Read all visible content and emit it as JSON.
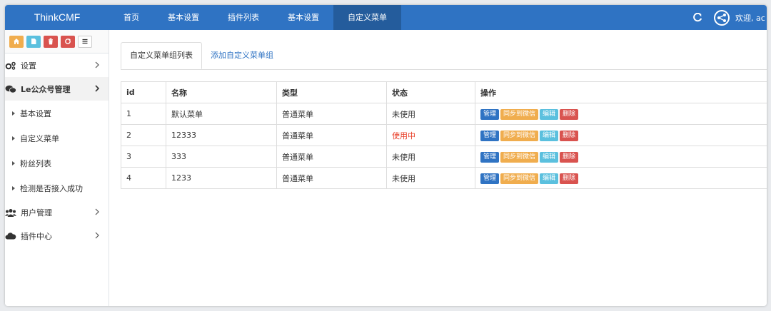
{
  "app": {
    "brand": "ThinkCMF"
  },
  "nav": {
    "items": [
      {
        "label": "首页"
      },
      {
        "label": "基本设置"
      },
      {
        "label": "插件列表"
      },
      {
        "label": "基本设置"
      },
      {
        "label": "自定义菜单"
      }
    ],
    "active_index": 4
  },
  "user": {
    "welcome": "欢迎, ac"
  },
  "sidebar": {
    "shortcuts": [
      {
        "icon": "home-icon",
        "color": "#f0ad4e"
      },
      {
        "icon": "file-icon",
        "color": "#5bc0de"
      },
      {
        "icon": "trash-icon",
        "color": "#d9534f"
      },
      {
        "icon": "recycle-icon",
        "color": "#d9534f"
      },
      {
        "icon": "list-icon",
        "color": "#ffffff"
      }
    ],
    "items": [
      {
        "label": "设置",
        "icon": "gears-icon"
      },
      {
        "label": "Le公众号管理",
        "icon": "wechat-icon"
      },
      {
        "label": "用户管理",
        "icon": "users-icon"
      },
      {
        "label": "插件中心",
        "icon": "cloud-icon"
      }
    ],
    "subitems": [
      {
        "label": "基本设置"
      },
      {
        "label": "自定义菜单"
      },
      {
        "label": "粉丝列表"
      },
      {
        "label": "检测是否接入成功"
      }
    ]
  },
  "tabs": [
    {
      "label": "自定义菜单组列表"
    },
    {
      "label": "添加自定义菜单组"
    }
  ],
  "table": {
    "headers": [
      "id",
      "名称",
      "类型",
      "状态",
      "操作"
    ],
    "rows": [
      {
        "id": "1",
        "name": "默认菜单",
        "type": "普通菜单",
        "status": "未使用"
      },
      {
        "id": "2",
        "name": "12333",
        "type": "普通菜单",
        "status": "使用中"
      },
      {
        "id": "3",
        "name": "333",
        "type": "普通菜单",
        "status": "未使用"
      },
      {
        "id": "4",
        "name": "1233",
        "type": "普通菜单",
        "status": "未使用"
      }
    ],
    "actions": {
      "manage": "管理",
      "sync": "同步到微信",
      "edit": "编辑",
      "delete": "删除"
    }
  },
  "colors": {
    "primary": "#2f73c3",
    "warning": "#f0ad4e",
    "info": "#5bc0de",
    "danger": "#d9534f",
    "status_active": "#e8402a"
  }
}
